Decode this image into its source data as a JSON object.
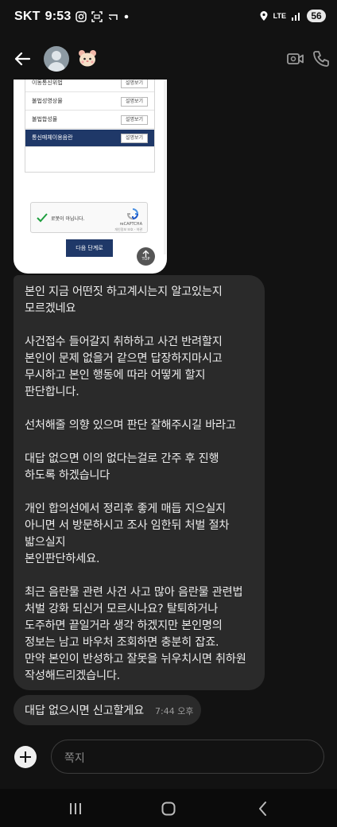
{
  "status_bar": {
    "carrier": "SKT",
    "time": "9:53",
    "network": "LTE",
    "battery": "56"
  },
  "header": {
    "back_icon": "arrow-left-icon",
    "video_icon": "video-call-icon",
    "phone_icon": "phone-icon"
  },
  "shared_screenshot": {
    "rows": [
      {
        "label": "이동통신위법",
        "button": "설명보기"
      },
      {
        "label": "불법성영상물",
        "button": "설명보기"
      },
      {
        "label": "불법합성물",
        "button": "설명보기"
      },
      {
        "label": "통신매체이용음란",
        "button": "설명보기"
      }
    ],
    "captcha_label": "로봇이 아닙니다.",
    "captcha_brand": "reCAPTCHA",
    "captcha_sub": "개인정보 보호 - 약관",
    "next_button": "다음 단계로",
    "top_button": "TOP"
  },
  "messages": [
    {
      "paragraphs": [
        "본인 지금 어떤짓 하고계시는지 알고있는지\n모르겠네요",
        "사건접수 들어갈지 취하하고 사건 반려할지\n본인이 문제 없을거 같으면 답장하지마시고\n무시하고 본인 행동에 따라 어떻게 할지\n판단합니다.",
        "선처해줄 의향 있으며 판단 잘해주시길 바라고",
        "대답 없으면 이의 없다는걸로 간주 후 진행\n하도록 하겠습니다",
        "개인 합의선에서 정리후 좋게 매듭 지으실지\n아니면 서 방문하시고 조사 임한뒤 처벌 절차\n밟으실지\n본인판단하세요.",
        "최근 음란물 관련 사건 사고 많아 음란물 관련법\n처벌 강화 되신거 모르시나요? 탈퇴하거나\n도주하면 끝일거라 생각 하겠지만 본인명의\n정보는 남고 바우처 조회하면 충분히 잡죠.\n만약 본인이 반성하고 잘못을 뉘우치시면 취하원\n작성해드리겠습니다."
      ]
    },
    {
      "text": "대답 없으시면 신고할게요",
      "time": "7:44 오후"
    }
  ],
  "composer": {
    "placeholder": "쪽지"
  },
  "colors": {
    "background": "#121212",
    "bubble": "#2a2a2a",
    "navy": "#1f3868"
  }
}
